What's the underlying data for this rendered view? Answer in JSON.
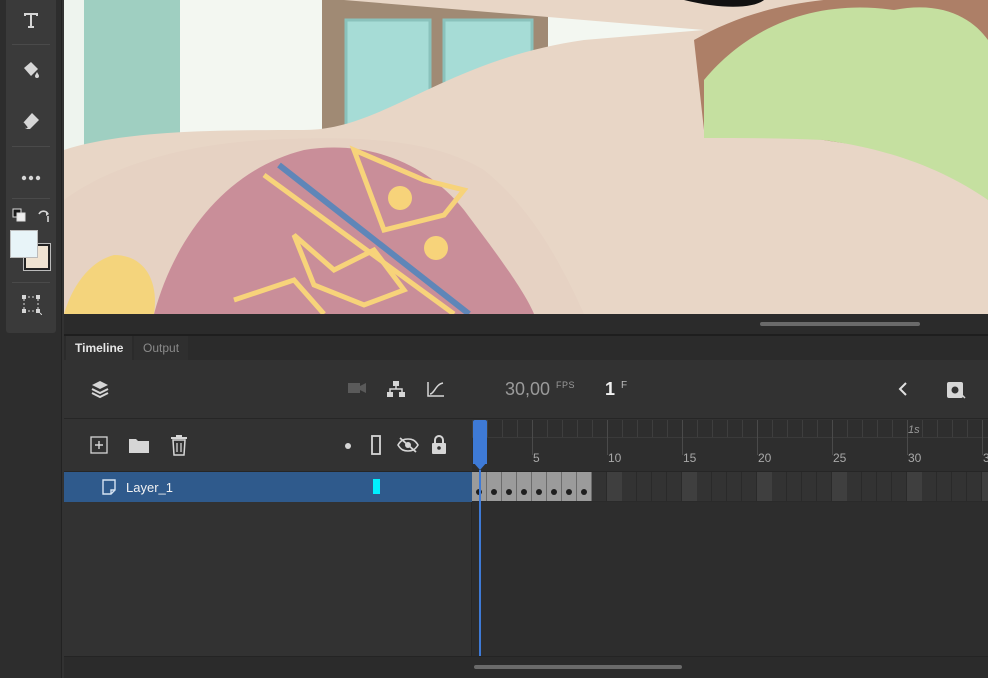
{
  "app": {
    "accent": "#3e7ad6",
    "layer_highlight": "#2f5a8c",
    "layer_color": "#00f0ff"
  },
  "tools": [
    {
      "name": "text-tool",
      "icon": "text-icon"
    },
    {
      "name": "paint-bucket-tool",
      "icon": "paint-bucket-icon"
    },
    {
      "name": "eraser-tool",
      "icon": "eraser-icon"
    },
    {
      "name": "more-tools",
      "icon": "ellipsis-icon"
    },
    {
      "name": "swap-colors",
      "icon": "swap-icon"
    },
    {
      "name": "fill-stroke-swatch",
      "icon": "color-swatch-icon"
    },
    {
      "name": "transform-tool",
      "icon": "free-transform-icon"
    }
  ],
  "panel": {
    "tabs": [
      {
        "label": "Timeline"
      },
      {
        "label": "Output"
      }
    ]
  },
  "timeline": {
    "fps_value": "30,00",
    "fps_unit": "FPS",
    "current_frame": "1",
    "frame_unit": "F",
    "ruler": {
      "labels": [
        "5",
        "10",
        "15",
        "20",
        "25",
        "30",
        "3"
      ],
      "second_marker": "1s"
    },
    "layers": [
      {
        "name": "Layer_1",
        "keyframes": 8
      }
    ]
  }
}
